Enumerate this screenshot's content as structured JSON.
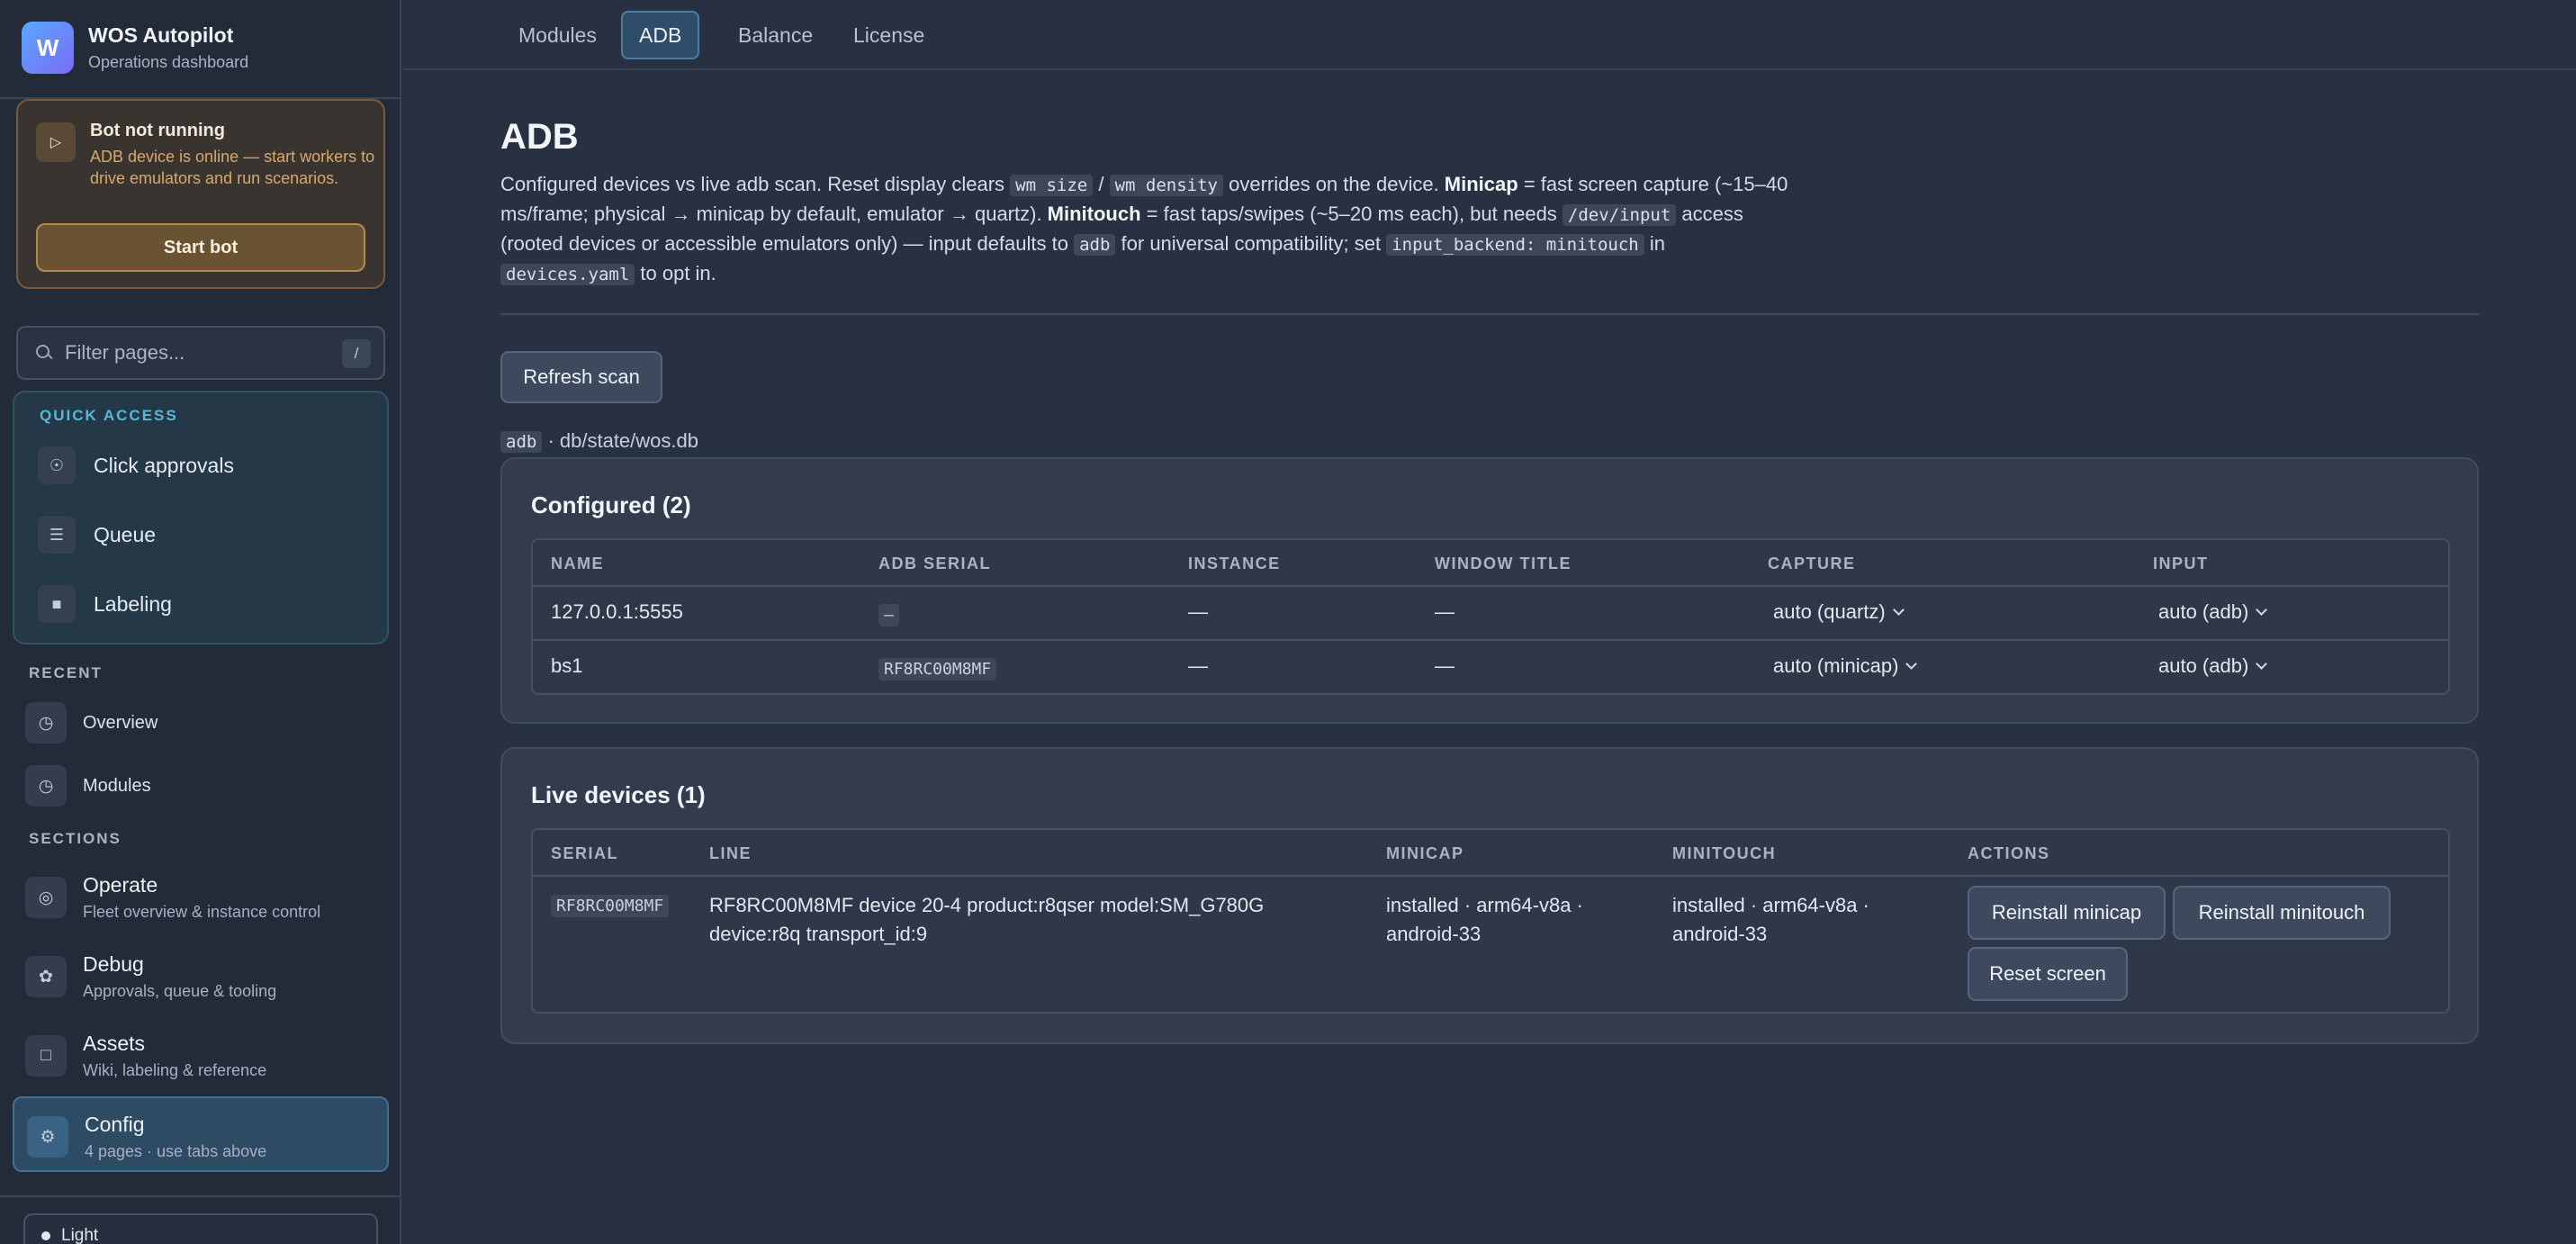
{
  "app": {
    "logo_letter": "W",
    "title": "WOS Autopilot",
    "subtitle": "Operations dashboard"
  },
  "bot": {
    "status_title": "Bot not running",
    "status_desc": "ADB device is online — start workers to drive emulators and run scenarios.",
    "start_label": "Start bot"
  },
  "filter": {
    "placeholder": "Filter pages...",
    "shortcut": "/"
  },
  "quick_access": {
    "label": "QUICK ACCESS",
    "items": [
      {
        "label": "Click approvals",
        "icon": "shield-check-icon"
      },
      {
        "label": "Queue",
        "icon": "list-icon"
      },
      {
        "label": "Labeling",
        "icon": "tag-icon"
      }
    ]
  },
  "recent": {
    "label": "RECENT",
    "items": [
      {
        "label": "Overview",
        "icon": "history-icon"
      },
      {
        "label": "Modules",
        "icon": "history-icon"
      }
    ]
  },
  "sections": {
    "label": "SECTIONS",
    "items": [
      {
        "title": "Operate",
        "sub": "Fleet overview & instance control",
        "icon": "target-icon"
      },
      {
        "title": "Debug",
        "sub": "Approvals, queue & tooling",
        "icon": "bug-icon"
      },
      {
        "title": "Assets",
        "sub": "Wiki, labeling & reference",
        "icon": "folder-icon"
      },
      {
        "title": "Config",
        "sub": "4 pages · use tabs above",
        "icon": "gear-icon"
      }
    ]
  },
  "theme": {
    "label": "Light"
  },
  "tabs": [
    {
      "label": "Modules"
    },
    {
      "label": "ADB"
    },
    {
      "label": "Balance"
    },
    {
      "label": "License"
    }
  ],
  "page": {
    "title": "ADB",
    "intro": {
      "t1": "Configured devices vs live adb scan. Reset display clears ",
      "c1": "wm size",
      "t2": " / ",
      "c2": "wm density",
      "t3": " overrides on the device. ",
      "b1": "Minicap",
      "t4": " = fast screen capture (~15–40 ms/frame; physical → minicap by default, emulator → quartz). ",
      "b2": "Minitouch",
      "t5": " = fast taps/swipes (~5–20 ms each), but needs ",
      "c3": "/dev/input",
      "t6": " access (rooted devices or accessible emulators only) — input defaults to ",
      "c4": "adb",
      "t7": " for universal compatibility; set ",
      "c5": "input_backend: minitouch",
      "t8": " in ",
      "c6": "devices.yaml",
      "t9": " to opt in."
    },
    "refresh_label": "Refresh scan",
    "db_tag": "adb",
    "db_path": "· db/state/wos.db"
  },
  "configured": {
    "title": "Configured (2)",
    "headers": [
      "NAME",
      "ADB SERIAL",
      "INSTANCE",
      "WINDOW TITLE",
      "CAPTURE",
      "INPUT"
    ],
    "rows": [
      {
        "name": "127.0.0.1:5555",
        "serial": "–",
        "instance": "—",
        "window_title": "—",
        "capture": "auto (quartz)",
        "input": "auto (adb)"
      },
      {
        "name": "bs1",
        "serial": "RF8RC00M8MF",
        "instance": "—",
        "window_title": "—",
        "capture": "auto (minicap)",
        "input": "auto (adb)"
      }
    ]
  },
  "live": {
    "title": "Live devices (1)",
    "headers": [
      "SERIAL",
      "LINE",
      "MINICAP",
      "MINITOUCH",
      "ACTIONS"
    ],
    "rows": [
      {
        "serial": "RF8RC00M8MF",
        "line": "RF8RC00M8MF device 20-4 product:r8qser model:SM_G780G device:r8q transport_id:9",
        "minicap": "installed · arm64-v8a · android-33",
        "minitouch": "installed · arm64-v8a · android-33",
        "actions": [
          "Reinstall minicap",
          "Reinstall minitouch",
          "Reset screen"
        ]
      }
    ]
  }
}
